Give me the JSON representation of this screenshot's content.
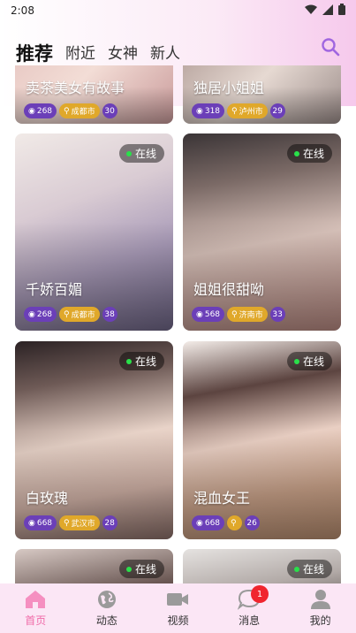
{
  "status_bar": {
    "time": "2:08"
  },
  "tabs": [
    {
      "label": "推荐",
      "active": true
    },
    {
      "label": "附近",
      "active": false
    },
    {
      "label": "女神",
      "active": false
    },
    {
      "label": "新人",
      "active": false
    }
  ],
  "cards": [
    {
      "name": "卖茶美女有故事",
      "views": "268",
      "city": "成都市",
      "age": "30",
      "online": ""
    },
    {
      "name": "独居小姐姐",
      "views": "318",
      "city": "泸州市",
      "age": "29",
      "online": ""
    },
    {
      "name": "千娇百媚",
      "views": "268",
      "city": "成都市",
      "age": "38",
      "online": "在线"
    },
    {
      "name": "姐姐很甜呦",
      "views": "568",
      "city": "济南市",
      "age": "33",
      "online": "在线"
    },
    {
      "name": "白玫瑰",
      "views": "668",
      "city": "武汉市",
      "age": "28",
      "online": "在线"
    },
    {
      "name": "混血女王",
      "views": "668",
      "city": "",
      "age": "26",
      "online": "在线"
    },
    {
      "name": "",
      "views": "",
      "city": "",
      "age": "",
      "online": "在线"
    },
    {
      "name": "",
      "views": "",
      "city": "",
      "age": "",
      "online": "在线"
    }
  ],
  "bottom_nav": [
    {
      "label": "首页",
      "icon": "home-icon",
      "active": true
    },
    {
      "label": "动态",
      "icon": "globe-icon",
      "active": false
    },
    {
      "label": "视频",
      "icon": "video-icon",
      "active": false
    },
    {
      "label": "消息",
      "icon": "chat-icon",
      "active": false,
      "badge": "1"
    },
    {
      "label": "我的",
      "icon": "user-icon",
      "active": false
    }
  ],
  "colors": {
    "accent": "#f06aa8",
    "search": "#a066e0",
    "badge_purple": "#6b3fb8",
    "badge_gold": "#e0a82a",
    "online_dot": "#29e04a"
  }
}
